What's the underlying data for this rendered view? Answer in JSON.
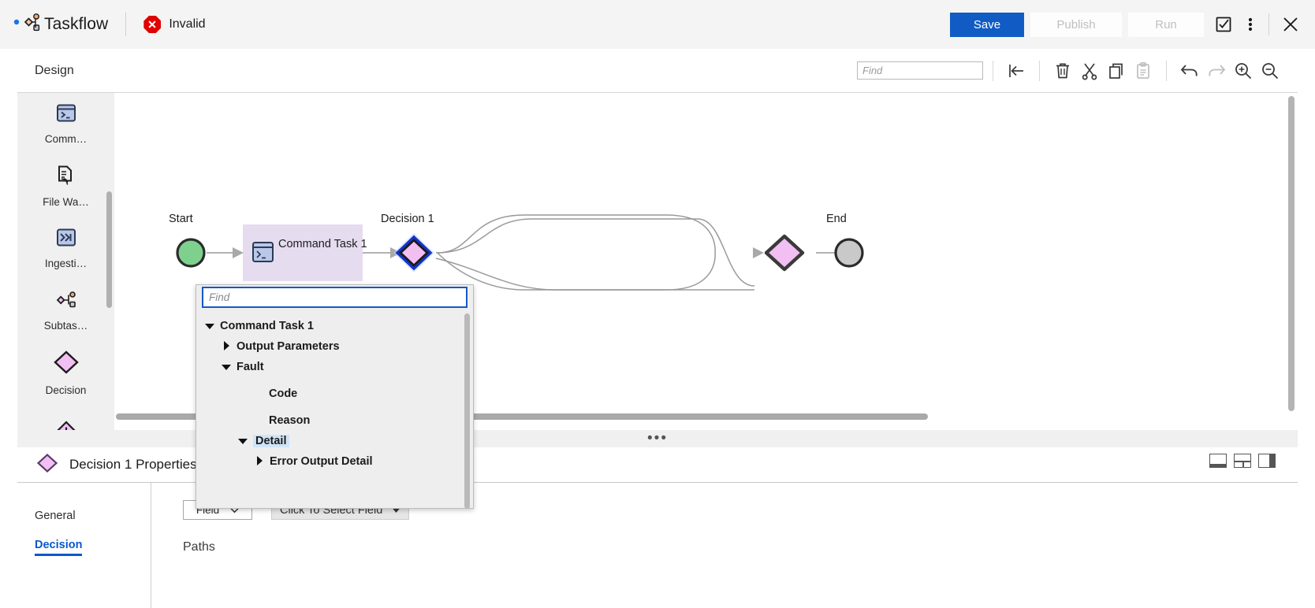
{
  "topbar": {
    "logo_icon": "taskflow-logo-icon",
    "title": "Taskflow",
    "status_icon": "error-octagon-icon",
    "status_text": "Invalid",
    "save_label": "Save",
    "publish_label": "Publish",
    "run_label": "Run",
    "validate_icon": "checkbox-validate-icon",
    "more_icon": "more-vertical-icon",
    "close_icon": "close-icon"
  },
  "designbar": {
    "label": "Design",
    "find_placeholder": "Find",
    "find_value": "",
    "icons": [
      {
        "name": "align-left-icon",
        "disabled": false
      },
      {
        "name": "delete-trash-icon",
        "disabled": false
      },
      {
        "name": "cut-scissors-icon",
        "disabled": false
      },
      {
        "name": "copy-icon",
        "disabled": false
      },
      {
        "name": "paste-icon",
        "disabled": true
      },
      {
        "name": "undo-icon",
        "disabled": false
      },
      {
        "name": "redo-icon",
        "disabled": true
      },
      {
        "name": "zoom-in-icon",
        "disabled": false
      },
      {
        "name": "zoom-out-icon",
        "disabled": false
      }
    ]
  },
  "palette": {
    "items": [
      {
        "label": "Comm…",
        "icon": "command-task-icon"
      },
      {
        "label": "File Wa…",
        "icon": "file-watch-icon"
      },
      {
        "label": "Ingesti…",
        "icon": "ingestion-task-icon"
      },
      {
        "label": "Subtas…",
        "icon": "subtaskflow-icon"
      },
      {
        "label": "Decision",
        "icon": "decision-diamond-icon"
      },
      {
        "label": "",
        "icon": "add-node-icon"
      }
    ]
  },
  "canvas": {
    "nodes": [
      {
        "id": "start",
        "label": "Start",
        "type": "start-circle"
      },
      {
        "id": "command-task-1",
        "label": "Command Task 1",
        "type": "task-box",
        "icon": "command-task-icon",
        "selected": true
      },
      {
        "id": "decision-1",
        "label": "Decision 1",
        "type": "decision-diamond",
        "selected": true
      },
      {
        "id": "merge",
        "label": "",
        "type": "decision-diamond"
      },
      {
        "id": "end",
        "label": "End",
        "type": "end-circle"
      }
    ]
  },
  "dropdown": {
    "find_placeholder": "Find",
    "find_value": "",
    "tree": [
      {
        "label": "Command Task 1",
        "state": "expanded",
        "indent": 0,
        "selected": false
      },
      {
        "label": "Output Parameters",
        "state": "collapsed",
        "indent": 1,
        "selected": false
      },
      {
        "label": "Fault",
        "state": "expanded",
        "indent": 1,
        "selected": false
      },
      {
        "label": "Code",
        "state": "leaf",
        "indent": 2,
        "selected": false
      },
      {
        "label": "Reason",
        "state": "leaf",
        "indent": 2,
        "selected": false
      },
      {
        "label": "Detail",
        "state": "expanded",
        "indent": 2,
        "selected": true
      },
      {
        "label": "Error Output Detail",
        "state": "collapsed",
        "indent": 3,
        "selected": false
      }
    ]
  },
  "properties": {
    "icon": "decision-diamond-icon",
    "title": "Decision 1 Properties",
    "tabs": [
      {
        "label": "General",
        "active": false
      },
      {
        "label": "Decision",
        "active": true
      }
    ],
    "field_select_value": "Field",
    "field_picker_label": "Click To Select Field",
    "paths_label": "Paths",
    "layout_icons": [
      "layout-single-icon",
      "layout-split-horizontal-icon",
      "layout-split-right-icon"
    ]
  },
  "colors": {
    "accent": "#115cc4",
    "error": "#e00000",
    "decision_fill": "#f2bff2",
    "start_fill": "#7ed18d",
    "end_fill": "#c9c9c9",
    "selection_fill": "#e5dcf0",
    "link_active": "#0a58ca"
  }
}
